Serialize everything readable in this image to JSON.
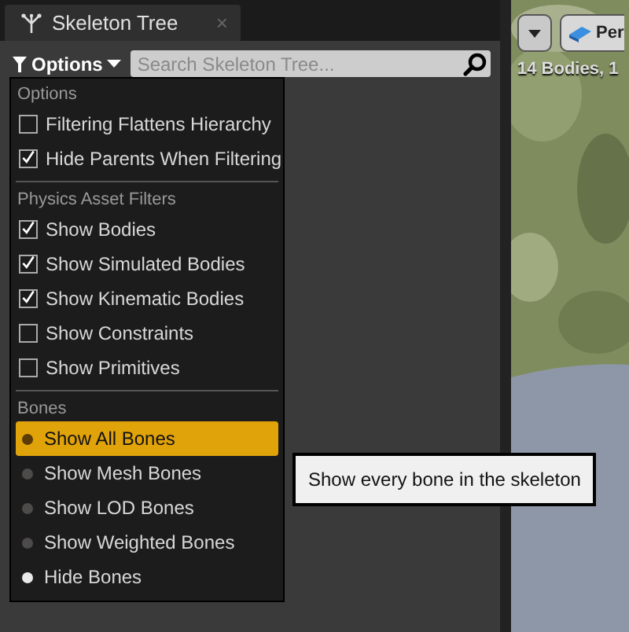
{
  "tab": {
    "title": "Skeleton Tree",
    "close": "×"
  },
  "toolbar": {
    "options_label": "Options",
    "search": {
      "placeholder": "Search Skeleton Tree..."
    }
  },
  "menu": {
    "sections": [
      {
        "heading": "Options",
        "items": [
          {
            "kind": "checkbox",
            "label": "Filtering Flattens Hierarchy",
            "checked": false
          },
          {
            "kind": "checkbox",
            "label": "Hide Parents When Filtering",
            "checked": true
          }
        ]
      },
      {
        "heading": "Physics Asset Filters",
        "items": [
          {
            "kind": "checkbox",
            "label": "Show Bodies",
            "checked": true
          },
          {
            "kind": "checkbox",
            "label": "Show Simulated Bodies",
            "checked": true
          },
          {
            "kind": "checkbox",
            "label": "Show Kinematic Bodies",
            "checked": true
          },
          {
            "kind": "checkbox",
            "label": "Show Constraints",
            "checked": false
          },
          {
            "kind": "checkbox",
            "label": "Show Primitives",
            "checked": false
          }
        ]
      },
      {
        "heading": "Bones",
        "items": [
          {
            "kind": "radio",
            "label": "Show All Bones",
            "selected": false,
            "highlighted": true
          },
          {
            "kind": "radio",
            "label": "Show Mesh Bones",
            "selected": false,
            "highlighted": false
          },
          {
            "kind": "radio",
            "label": "Show LOD Bones",
            "selected": false,
            "highlighted": false
          },
          {
            "kind": "radio",
            "label": "Show Weighted Bones",
            "selected": false,
            "highlighted": false
          },
          {
            "kind": "radio",
            "label": "Hide Bones",
            "selected": true,
            "highlighted": false
          }
        ]
      }
    ]
  },
  "tooltip": "Show every bone in the skeleton",
  "viewport": {
    "view_button": "Per",
    "stats": "14 Bodies, 1"
  }
}
